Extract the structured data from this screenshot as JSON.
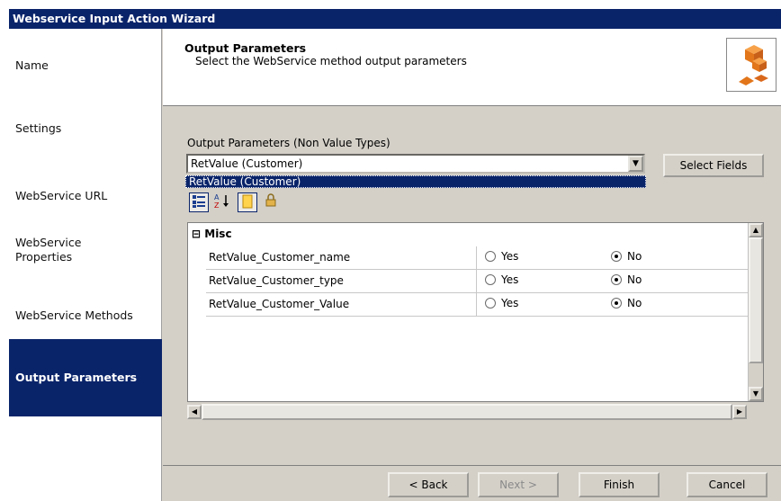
{
  "window": {
    "title": "Webservice Input Action Wizard"
  },
  "sidebar": {
    "items": [
      {
        "label": "Name"
      },
      {
        "label": "Settings"
      },
      {
        "label": "WebService URL"
      },
      {
        "label": "WebService\nProperties"
      },
      {
        "label": "WebService Methods"
      },
      {
        "label": "Output Parameters",
        "active": true
      }
    ]
  },
  "header": {
    "title": "Output Parameters",
    "subtitle": "Select the WebService method output parameters",
    "icon": "boxes-icon"
  },
  "content": {
    "params_label": "Output Parameters (Non Value Types)",
    "combo_value": "RetValue (Customer)",
    "dropdown_options": [
      "RetValue (Customer)"
    ],
    "select_fields_label": "Select Fields"
  },
  "toolbar": {
    "categorized_icon": "categorized-icon",
    "alphabetical_icon": "sort-az-icon",
    "properties_icon": "properties-icon",
    "events_icon": "lock-icon"
  },
  "grid": {
    "category": "Misc",
    "yes_label": "Yes",
    "no_label": "No",
    "rows": [
      {
        "name": "RetValue_Customer_name",
        "value": "No"
      },
      {
        "name": "RetValue_Customer_type",
        "value": "No"
      },
      {
        "name": "RetValue_Customer_Value",
        "value": "No"
      }
    ]
  },
  "footer": {
    "back_label": "< Back",
    "next_label": "Next >",
    "finish_label": "Finish",
    "cancel_label": "Cancel"
  },
  "colors": {
    "accent": "#0a246a",
    "face": "#d4d0c8"
  }
}
